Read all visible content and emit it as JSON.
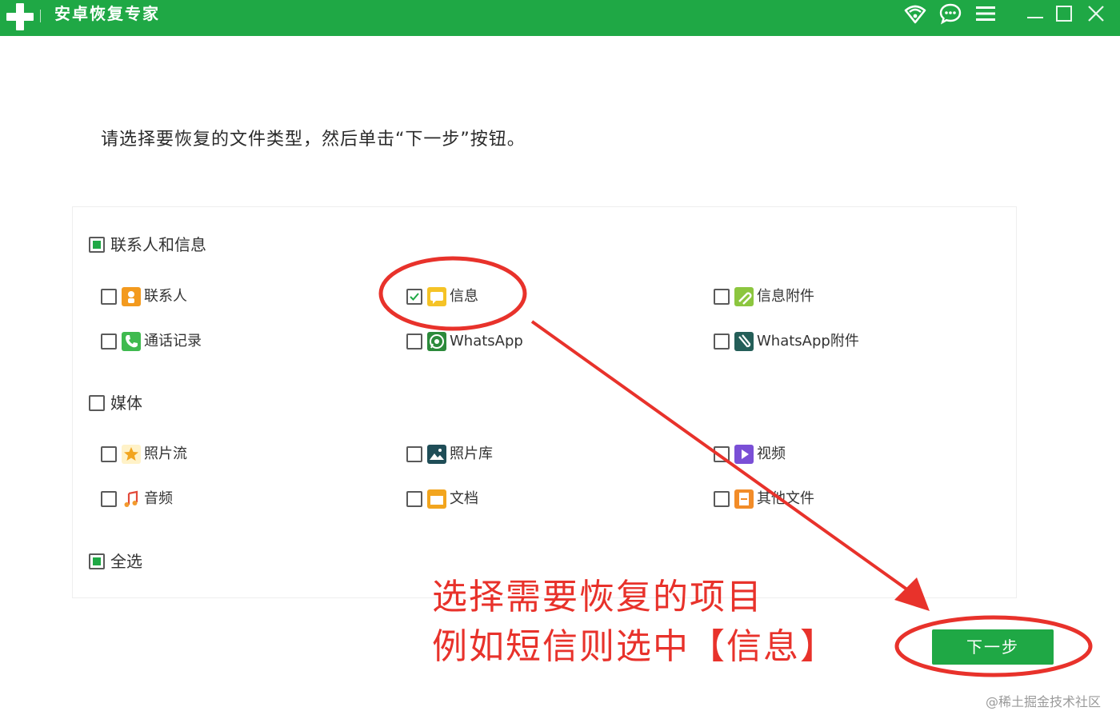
{
  "window": {
    "title": "安卓恢复专家",
    "icons": [
      "wifi-icon",
      "chat-icon",
      "menu-icon",
      "minimize-icon",
      "maximize-icon",
      "close-icon"
    ]
  },
  "instruction": "请选择要恢复的文件类型，然后单击“下一步”按钮。",
  "groups": {
    "contacts_messages": {
      "label": "联系人和信息",
      "state": "partial",
      "items": [
        {
          "label": "联系人",
          "icon": "contact-icon",
          "checked": false
        },
        {
          "label": "信息",
          "icon": "message-icon",
          "checked": true
        },
        {
          "label": "信息附件",
          "icon": "attachment-icon",
          "checked": false
        },
        {
          "label": "通话记录",
          "icon": "phone-icon",
          "checked": false
        },
        {
          "label": "WhatsApp",
          "icon": "whatsapp-icon",
          "checked": false
        },
        {
          "label": "WhatsApp附件",
          "icon": "whatsapp-attachment-icon",
          "checked": false
        }
      ]
    },
    "media": {
      "label": "媒体",
      "state": "unchecked",
      "items": [
        {
          "label": "照片流",
          "icon": "photostream-icon",
          "checked": false
        },
        {
          "label": "照片库",
          "icon": "photo-library-icon",
          "checked": false
        },
        {
          "label": "视频",
          "icon": "video-icon",
          "checked": false
        },
        {
          "label": "音频",
          "icon": "audio-icon",
          "checked": false
        },
        {
          "label": "文档",
          "icon": "document-icon",
          "checked": false
        },
        {
          "label": "其他文件",
          "icon": "other-file-icon",
          "checked": false
        }
      ]
    }
  },
  "select_all": {
    "label": "全选",
    "state": "partial"
  },
  "annotation": {
    "line1": "选择需要恢复的项目",
    "line2": "例如短信则选中【信息】"
  },
  "next_button": "下一步",
  "watermark": "@稀土掘金技术社区",
  "colors": {
    "brand_green": "#1fa845",
    "annotation_red": "#e8322b"
  }
}
